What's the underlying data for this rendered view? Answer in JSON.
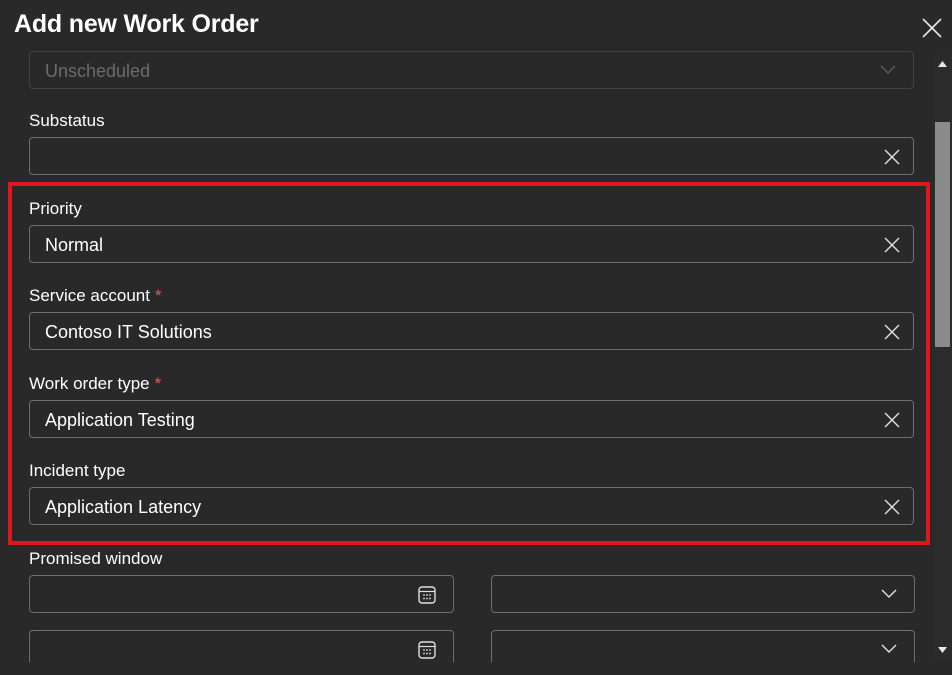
{
  "dialog": {
    "title": "Add new Work Order"
  },
  "fields": {
    "system_status": {
      "value": "Unscheduled"
    },
    "substatus": {
      "label": "Substatus",
      "value": ""
    },
    "priority": {
      "label": "Priority",
      "value": "Normal"
    },
    "service_account": {
      "label": "Service account",
      "required_mark": "*",
      "value": "Contoso IT Solutions"
    },
    "work_order_type": {
      "label": "Work order type",
      "required_mark": "*",
      "value": "Application Testing"
    },
    "incident_type": {
      "label": "Incident type",
      "value": "Application Latency"
    },
    "promised_window": {
      "label": "Promised window"
    }
  },
  "icons": {
    "close": "close-icon",
    "clear": "clear-icon",
    "chevron": "chevron-down-icon",
    "calendar": "calendar-icon"
  },
  "colors": {
    "background": "#292929",
    "field_border": "#6e6e6e",
    "highlight": "#e0161f",
    "required": "#e55b5b",
    "scroll_thumb": "#8a8a8a"
  }
}
